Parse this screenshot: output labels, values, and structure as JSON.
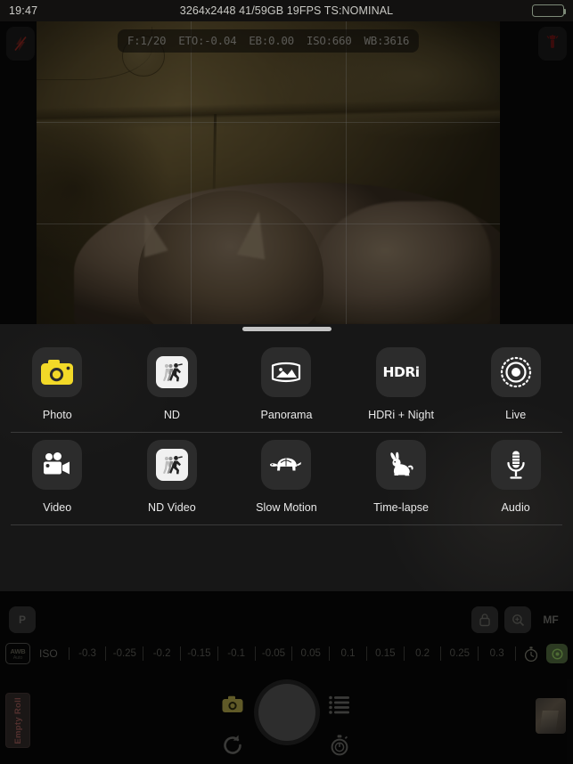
{
  "statusbar": {
    "time": "19:47",
    "center_info": "3264x2448 41/59GB  19FPS TS:NOMINAL",
    "battery_icon": "battery-full-icon"
  },
  "viewfinder": {
    "flash_button": {
      "icon": "flash-off-icon",
      "label": ""
    },
    "torch_button": {
      "icon": "torch-icon",
      "label": ""
    },
    "exif": [
      {
        "name": "shutter",
        "text": "F:1/20"
      },
      {
        "name": "exposure-target-offset",
        "text": "ETO:-0.04"
      },
      {
        "name": "exposure-bias",
        "text": "EB:0.00"
      },
      {
        "name": "iso",
        "text": "ISO:660"
      },
      {
        "name": "white-balance",
        "text": "WB:3616"
      }
    ]
  },
  "mode_sheet": {
    "rows": [
      [
        {
          "label": "Photo",
          "icon": "camera-icon",
          "selected": true
        },
        {
          "label": "ND",
          "icon": "nd-runner-icon",
          "selected": false
        },
        {
          "label": "Panorama",
          "icon": "panorama-icon",
          "selected": false
        },
        {
          "label": "HDRi + Night",
          "icon": "hdri-text-icon",
          "selected": false
        },
        {
          "label": "Live",
          "icon": "live-photo-icon",
          "selected": false
        }
      ],
      [
        {
          "label": "Video",
          "icon": "video-camera-icon",
          "selected": false
        },
        {
          "label": "ND Video",
          "icon": "nd-runner-icon",
          "selected": false
        },
        {
          "label": "Slow Motion",
          "icon": "turtle-icon",
          "selected": false
        },
        {
          "label": "Time-lapse",
          "icon": "rabbit-icon",
          "selected": false
        },
        {
          "label": "Audio",
          "icon": "microphone-icon",
          "selected": false
        }
      ]
    ]
  },
  "tool_row": {
    "program_button": "P",
    "lock_icon": "lock-icon",
    "zoom_icon": "magnifier-plus-icon",
    "manual_focus_button": "MF"
  },
  "exposure_row": {
    "awb_label": "AWB",
    "awb_sub": "Auto",
    "iso_label": "ISO",
    "ticks": [
      "-0.3",
      "-0.25",
      "-0.2",
      "-0.15",
      "-0.1",
      "-0.05",
      "0.05",
      "0.1",
      "0.15",
      "0.2",
      "0.25",
      "0.3"
    ],
    "timer_icon": "stopwatch-icon",
    "green_icon": "shutter-green-icon"
  },
  "bottom_bar": {
    "roll_label": "Empty Roll",
    "camera_icon": "camera-icon",
    "list_icon": "list-icon",
    "refresh_icon": "rotate-icon",
    "timer_icon": "stopwatch-icon",
    "shutter_button": "shutter-button",
    "thumbnail": "last-photo-thumbnail"
  },
  "colors": {
    "accent_yellow": "#f2d928",
    "sheet_bg": "#181818",
    "icon_tile": "#2c2c2c",
    "battery_green": "#4a7a3a",
    "torch_red": "#a02020"
  }
}
